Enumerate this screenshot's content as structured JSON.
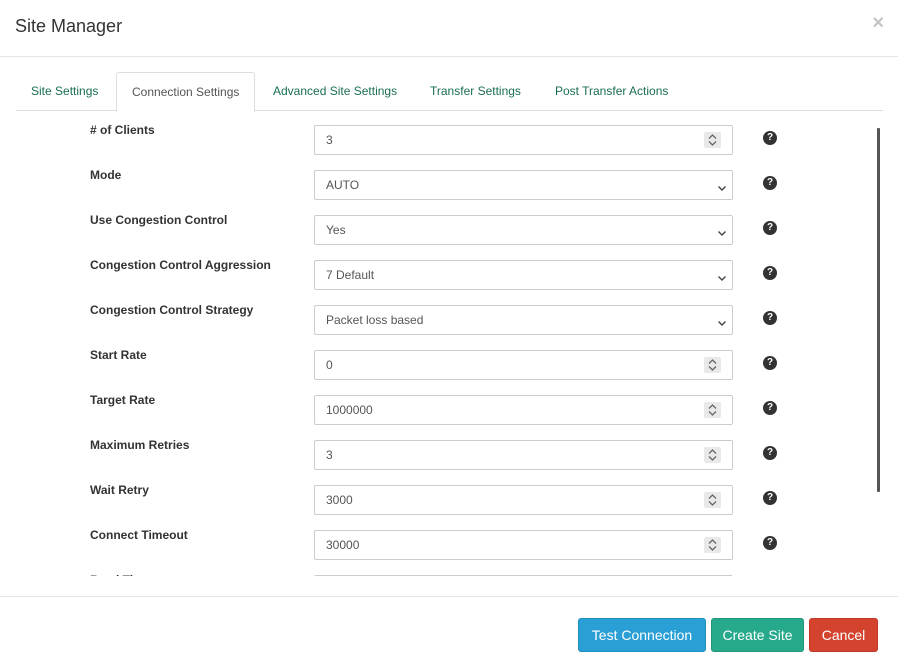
{
  "dialog": {
    "title": "Site Manager",
    "close_label": "×"
  },
  "tabs": [
    {
      "label": "Site Settings",
      "active": false
    },
    {
      "label": "Connection Settings",
      "active": true
    },
    {
      "label": "Advanced Site Settings",
      "active": false
    },
    {
      "label": "Transfer Settings",
      "active": false
    },
    {
      "label": "Post Transfer Actions",
      "active": false
    }
  ],
  "fields": [
    {
      "label": "# of Clients",
      "value": "3",
      "kind": "number"
    },
    {
      "label": "Mode",
      "value": "AUTO",
      "kind": "select"
    },
    {
      "label": "Use Congestion Control",
      "value": "Yes",
      "kind": "select"
    },
    {
      "label": "Congestion Control Aggression",
      "value": "7 Default",
      "kind": "select"
    },
    {
      "label": "Congestion Control Strategy",
      "value": "Packet loss based",
      "kind": "select"
    },
    {
      "label": "Start Rate",
      "value": "0",
      "kind": "number"
    },
    {
      "label": "Target Rate",
      "value": "1000000",
      "kind": "number"
    },
    {
      "label": "Maximum Retries",
      "value": "3",
      "kind": "number"
    },
    {
      "label": "Wait Retry",
      "value": "3000",
      "kind": "number"
    },
    {
      "label": "Connect Timeout",
      "value": "30000",
      "kind": "number"
    },
    {
      "label": "Read Timeout",
      "value": "",
      "kind": "number"
    }
  ],
  "help_icon": "question-circle-icon",
  "footer": {
    "test_label": "Test Connection",
    "create_label": "Create Site",
    "cancel_label": "Cancel"
  },
  "colors": {
    "tab_link": "#1a6e52",
    "test_button": "#2a9fd6",
    "create_button": "#27a98b",
    "cancel_button": "#d3432e"
  }
}
